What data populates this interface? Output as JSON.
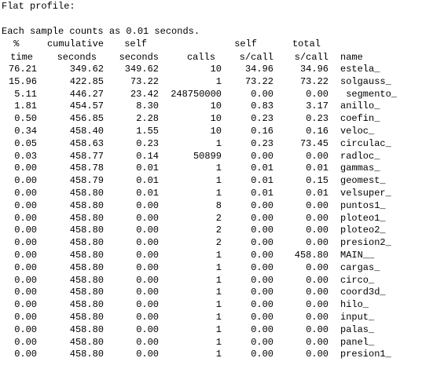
{
  "title": "Flat profile:",
  "sample_note": "Each sample counts as 0.01 seconds.",
  "header1": {
    "time": " %",
    "cumulative": "cumulative",
    "self": "self",
    "calls": "",
    "self_s_call": "self",
    "total_s_call": "total",
    "name": ""
  },
  "header2": {
    "time": "time",
    "cumulative": "seconds",
    "self": "seconds",
    "calls": "calls",
    "self_s_call": "s/call",
    "total_s_call": "s/call",
    "name": "name"
  },
  "rows": [
    {
      "time": "76.21",
      "cumulative": "349.62",
      "self": "349.62",
      "calls": "10",
      "self_s_call": "34.96",
      "total_s_call": "34.96",
      "name": "estela_"
    },
    {
      "time": "15.96",
      "cumulative": "422.85",
      "self": "73.22",
      "calls": "1",
      "self_s_call": "73.22",
      "total_s_call": "73.22",
      "name": "solgauss_"
    },
    {
      "time": "5.11",
      "cumulative": "446.27",
      "self": "23.42",
      "calls": "248750000",
      "self_s_call": "0.00",
      "total_s_call": "0.00",
      "name": " segmento_"
    },
    {
      "time": "1.81",
      "cumulative": "454.57",
      "self": "8.30",
      "calls": "10",
      "self_s_call": "0.83",
      "total_s_call": "3.17",
      "name": "anillo_"
    },
    {
      "time": "0.50",
      "cumulative": "456.85",
      "self": "2.28",
      "calls": "10",
      "self_s_call": "0.23",
      "total_s_call": "0.23",
      "name": "coefin_"
    },
    {
      "time": "0.34",
      "cumulative": "458.40",
      "self": "1.55",
      "calls": "10",
      "self_s_call": "0.16",
      "total_s_call": "0.16",
      "name": "veloc_"
    },
    {
      "time": "0.05",
      "cumulative": "458.63",
      "self": "0.23",
      "calls": "1",
      "self_s_call": "0.23",
      "total_s_call": "73.45",
      "name": "circulac_"
    },
    {
      "time": "0.03",
      "cumulative": "458.77",
      "self": "0.14",
      "calls": "50899",
      "self_s_call": "0.00",
      "total_s_call": "0.00",
      "name": "radloc_"
    },
    {
      "time": "0.00",
      "cumulative": "458.78",
      "self": "0.01",
      "calls": "1",
      "self_s_call": "0.01",
      "total_s_call": "0.01",
      "name": "gammas_"
    },
    {
      "time": "0.00",
      "cumulative": "458.79",
      "self": "0.01",
      "calls": "1",
      "self_s_call": "0.01",
      "total_s_call": "0.15",
      "name": "geomest_"
    },
    {
      "time": "0.00",
      "cumulative": "458.80",
      "self": "0.01",
      "calls": "1",
      "self_s_call": "0.01",
      "total_s_call": "0.01",
      "name": "velsuper_"
    },
    {
      "time": "0.00",
      "cumulative": "458.80",
      "self": "0.00",
      "calls": "8",
      "self_s_call": "0.00",
      "total_s_call": "0.00",
      "name": "puntos1_"
    },
    {
      "time": "0.00",
      "cumulative": "458.80",
      "self": "0.00",
      "calls": "2",
      "self_s_call": "0.00",
      "total_s_call": "0.00",
      "name": "ploteo1_"
    },
    {
      "time": "0.00",
      "cumulative": "458.80",
      "self": "0.00",
      "calls": "2",
      "self_s_call": "0.00",
      "total_s_call": "0.00",
      "name": "ploteo2_"
    },
    {
      "time": "0.00",
      "cumulative": "458.80",
      "self": "0.00",
      "calls": "2",
      "self_s_call": "0.00",
      "total_s_call": "0.00",
      "name": "presion2_"
    },
    {
      "time": "0.00",
      "cumulative": "458.80",
      "self": "0.00",
      "calls": "1",
      "self_s_call": "0.00",
      "total_s_call": "458.80",
      "name": "MAIN__"
    },
    {
      "time": "0.00",
      "cumulative": "458.80",
      "self": "0.00",
      "calls": "1",
      "self_s_call": "0.00",
      "total_s_call": "0.00",
      "name": "cargas_"
    },
    {
      "time": "0.00",
      "cumulative": "458.80",
      "self": "0.00",
      "calls": "1",
      "self_s_call": "0.00",
      "total_s_call": "0.00",
      "name": "circo_"
    },
    {
      "time": "0.00",
      "cumulative": "458.80",
      "self": "0.00",
      "calls": "1",
      "self_s_call": "0.00",
      "total_s_call": "0.00",
      "name": "coord3d_"
    },
    {
      "time": "0.00",
      "cumulative": "458.80",
      "self": "0.00",
      "calls": "1",
      "self_s_call": "0.00",
      "total_s_call": "0.00",
      "name": "hilo_"
    },
    {
      "time": "0.00",
      "cumulative": "458.80",
      "self": "0.00",
      "calls": "1",
      "self_s_call": "0.00",
      "total_s_call": "0.00",
      "name": "input_"
    },
    {
      "time": "0.00",
      "cumulative": "458.80",
      "self": "0.00",
      "calls": "1",
      "self_s_call": "0.00",
      "total_s_call": "0.00",
      "name": "palas_"
    },
    {
      "time": "0.00",
      "cumulative": "458.80",
      "self": "0.00",
      "calls": "1",
      "self_s_call": "0.00",
      "total_s_call": "0.00",
      "name": "panel_"
    },
    {
      "time": "0.00",
      "cumulative": "458.80",
      "self": "0.00",
      "calls": "1",
      "self_s_call": "0.00",
      "total_s_call": "0.00",
      "name": "presion1_"
    }
  ]
}
